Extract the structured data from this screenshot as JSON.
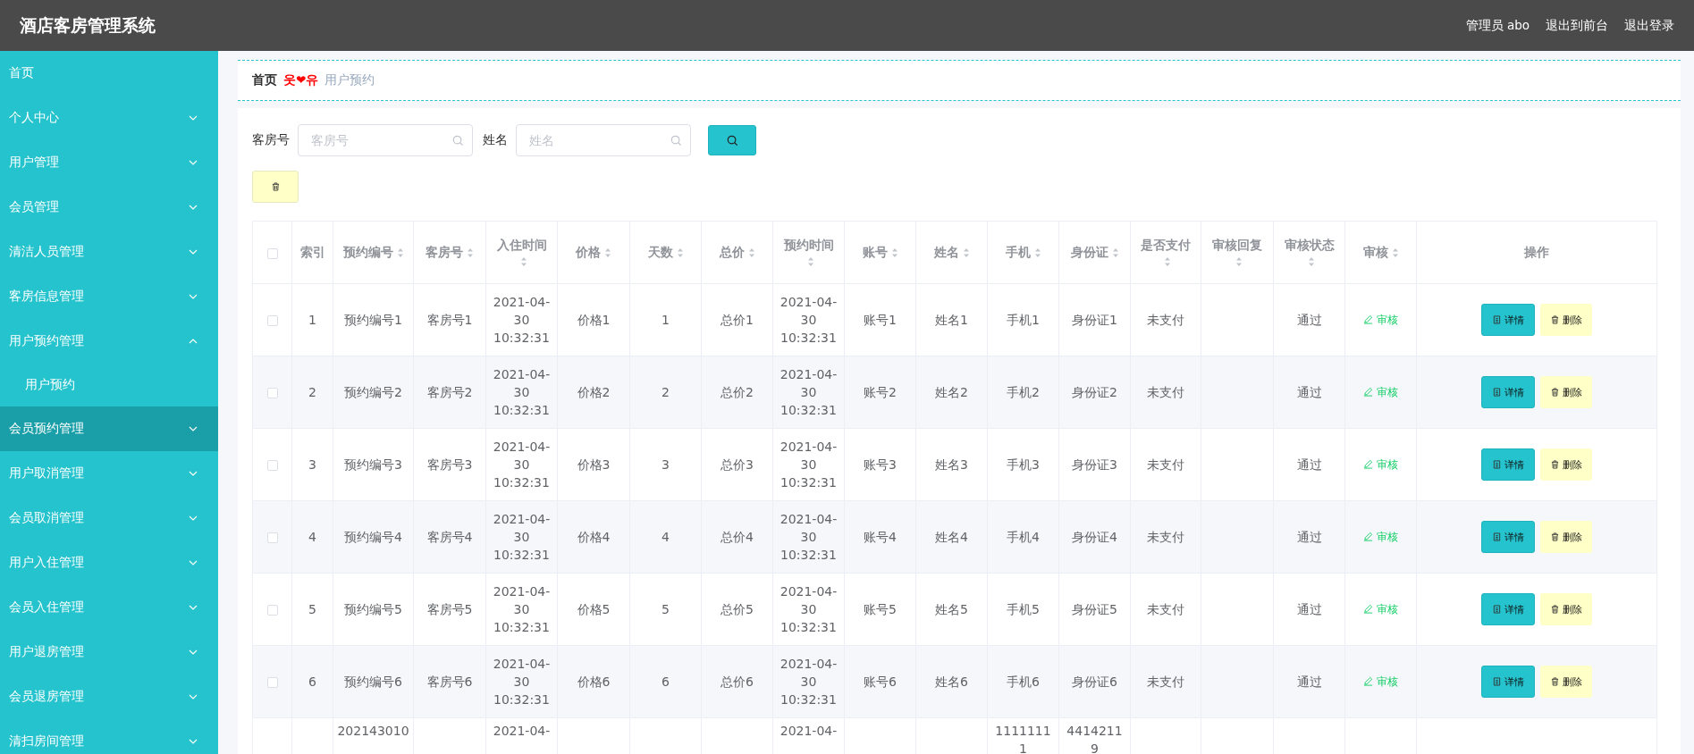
{
  "header": {
    "title": "酒店客房管理系统",
    "links": [
      "管理员 abo",
      "退出到前台",
      "退出登录"
    ]
  },
  "sidebar": {
    "items": [
      {
        "label": "首页",
        "selected": false
      },
      {
        "label": "个人中心",
        "selected": false,
        "expanded": false
      },
      {
        "label": "用户管理",
        "selected": false,
        "expanded": false
      },
      {
        "label": "会员管理",
        "selected": false,
        "expanded": false
      },
      {
        "label": "清洁人员管理",
        "selected": false,
        "expanded": false
      },
      {
        "label": "客房信息管理",
        "selected": false,
        "expanded": false
      },
      {
        "label": "用户预约管理",
        "selected": false,
        "expanded": true,
        "children": [
          {
            "label": "用户预约",
            "selected": false
          }
        ]
      },
      {
        "label": "会员预约管理",
        "selected": true,
        "expanded": false
      },
      {
        "label": "用户取消管理",
        "selected": false,
        "expanded": false
      },
      {
        "label": "会员取消管理",
        "selected": false,
        "expanded": false
      },
      {
        "label": "用户入住管理",
        "selected": false,
        "expanded": false
      },
      {
        "label": "会员入住管理",
        "selected": false,
        "expanded": false
      },
      {
        "label": "用户退房管理",
        "selected": false,
        "expanded": false
      },
      {
        "label": "会员退房管理",
        "selected": false,
        "expanded": false
      },
      {
        "label": "清扫房间管理",
        "selected": false,
        "expanded": false
      }
    ]
  },
  "breadcrumb": {
    "home": "首页",
    "separator": "웃❤유",
    "current": "用户预约"
  },
  "search": {
    "fields": [
      {
        "label": "客房号",
        "placeholder": "客房号"
      },
      {
        "label": "姓名",
        "placeholder": "姓名"
      }
    ]
  },
  "table": {
    "columns": [
      {
        "kind": "check",
        "checked": false
      },
      {
        "kind": "text",
        "label": "索引",
        "sortable": false
      },
      {
        "kind": "text",
        "label": "预约编号",
        "sortable": true
      },
      {
        "kind": "text",
        "label": "客房号",
        "sortable": true
      },
      {
        "kind": "text",
        "label": "入住时间",
        "sortable": true
      },
      {
        "kind": "text",
        "label": "价格",
        "sortable": true
      },
      {
        "kind": "text",
        "label": "天数",
        "sortable": true
      },
      {
        "kind": "text",
        "label": "总价",
        "sortable": true
      },
      {
        "kind": "text",
        "label": "预约时间",
        "sortable": true
      },
      {
        "kind": "text",
        "label": "账号",
        "sortable": true
      },
      {
        "kind": "text",
        "label": "姓名",
        "sortable": true
      },
      {
        "kind": "text",
        "label": "手机",
        "sortable": true
      },
      {
        "kind": "text",
        "label": "身份证",
        "sortable": true
      },
      {
        "kind": "text",
        "label": "是否支付",
        "sortable": true
      },
      {
        "kind": "text",
        "label": "审核回复",
        "sortable": true
      },
      {
        "kind": "text",
        "label": "审核状态",
        "sortable": true
      },
      {
        "kind": "link",
        "label": "审核",
        "sortable": true
      },
      {
        "kind": "actions",
        "label": "操作",
        "sortable": false
      }
    ],
    "rows": [
      {
        "kind": "full",
        "checked": false,
        "cells": [
          null,
          "1",
          "预约编号1",
          "客房号1",
          "2021-04-30 10:32:31",
          "价格1",
          "1",
          "总价1",
          "2021-04-30 10:32:31",
          "账号1",
          "姓名1",
          "手机1",
          "身份证1",
          "未支付",
          null,
          "通过",
          "审核"
        ],
        "actions": [
          "详情",
          "删除"
        ]
      },
      {
        "kind": "full",
        "checked": false,
        "cells": [
          null,
          "2",
          "预约编号2",
          "客房号2",
          "2021-04-30 10:32:31",
          "价格2",
          "2",
          "总价2",
          "2021-04-30 10:32:31",
          "账号2",
          "姓名2",
          "手机2",
          "身份证2",
          "未支付",
          null,
          "通过",
          "审核"
        ],
        "actions": [
          "详情",
          "删除"
        ]
      },
      {
        "kind": "full",
        "checked": false,
        "cells": [
          null,
          "3",
          "预约编号3",
          "客房号3",
          "2021-04-30 10:32:31",
          "价格3",
          "3",
          "总价3",
          "2021-04-30 10:32:31",
          "账号3",
          "姓名3",
          "手机3",
          "身份证3",
          "未支付",
          null,
          "通过",
          "审核"
        ],
        "actions": [
          "详情",
          "删除"
        ]
      },
      {
        "kind": "full",
        "checked": false,
        "cells": [
          null,
          "4",
          "预约编号4",
          "客房号4",
          "2021-04-30 10:32:31",
          "价格4",
          "4",
          "总价4",
          "2021-04-30 10:32:31",
          "账号4",
          "姓名4",
          "手机4",
          "身份证4",
          "未支付",
          null,
          "通过",
          "审核"
        ],
        "actions": [
          "详情",
          "删除"
        ]
      },
      {
        "kind": "full",
        "checked": false,
        "cells": [
          null,
          "5",
          "预约编号5",
          "客房号5",
          "2021-04-30 10:32:31",
          "价格5",
          "5",
          "总价5",
          "2021-04-30 10:32:31",
          "账号5",
          "姓名5",
          "手机5",
          "身份证5",
          "未支付",
          null,
          "通过",
          "审核"
        ],
        "actions": [
          "详情",
          "删除"
        ]
      },
      {
        "kind": "full",
        "checked": false,
        "cells": [
          null,
          "6",
          "预约编号6",
          "客房号6",
          "2021-04-30 10:32:31",
          "价格6",
          "6",
          "总价6",
          "2021-04-30 10:32:31",
          "账号6",
          "姓名6",
          "手机6",
          "身份证6",
          "未支付",
          null,
          "通过",
          "审核"
        ],
        "actions": [
          "详情",
          "删除"
        ]
      },
      {
        "kind": "cut",
        "cells": [
          null,
          null,
          "202143010",
          null,
          "2021-04-",
          null,
          null,
          null,
          "2021-04-",
          null,
          null,
          "11111111",
          "44142119"
        ]
      }
    ]
  }
}
